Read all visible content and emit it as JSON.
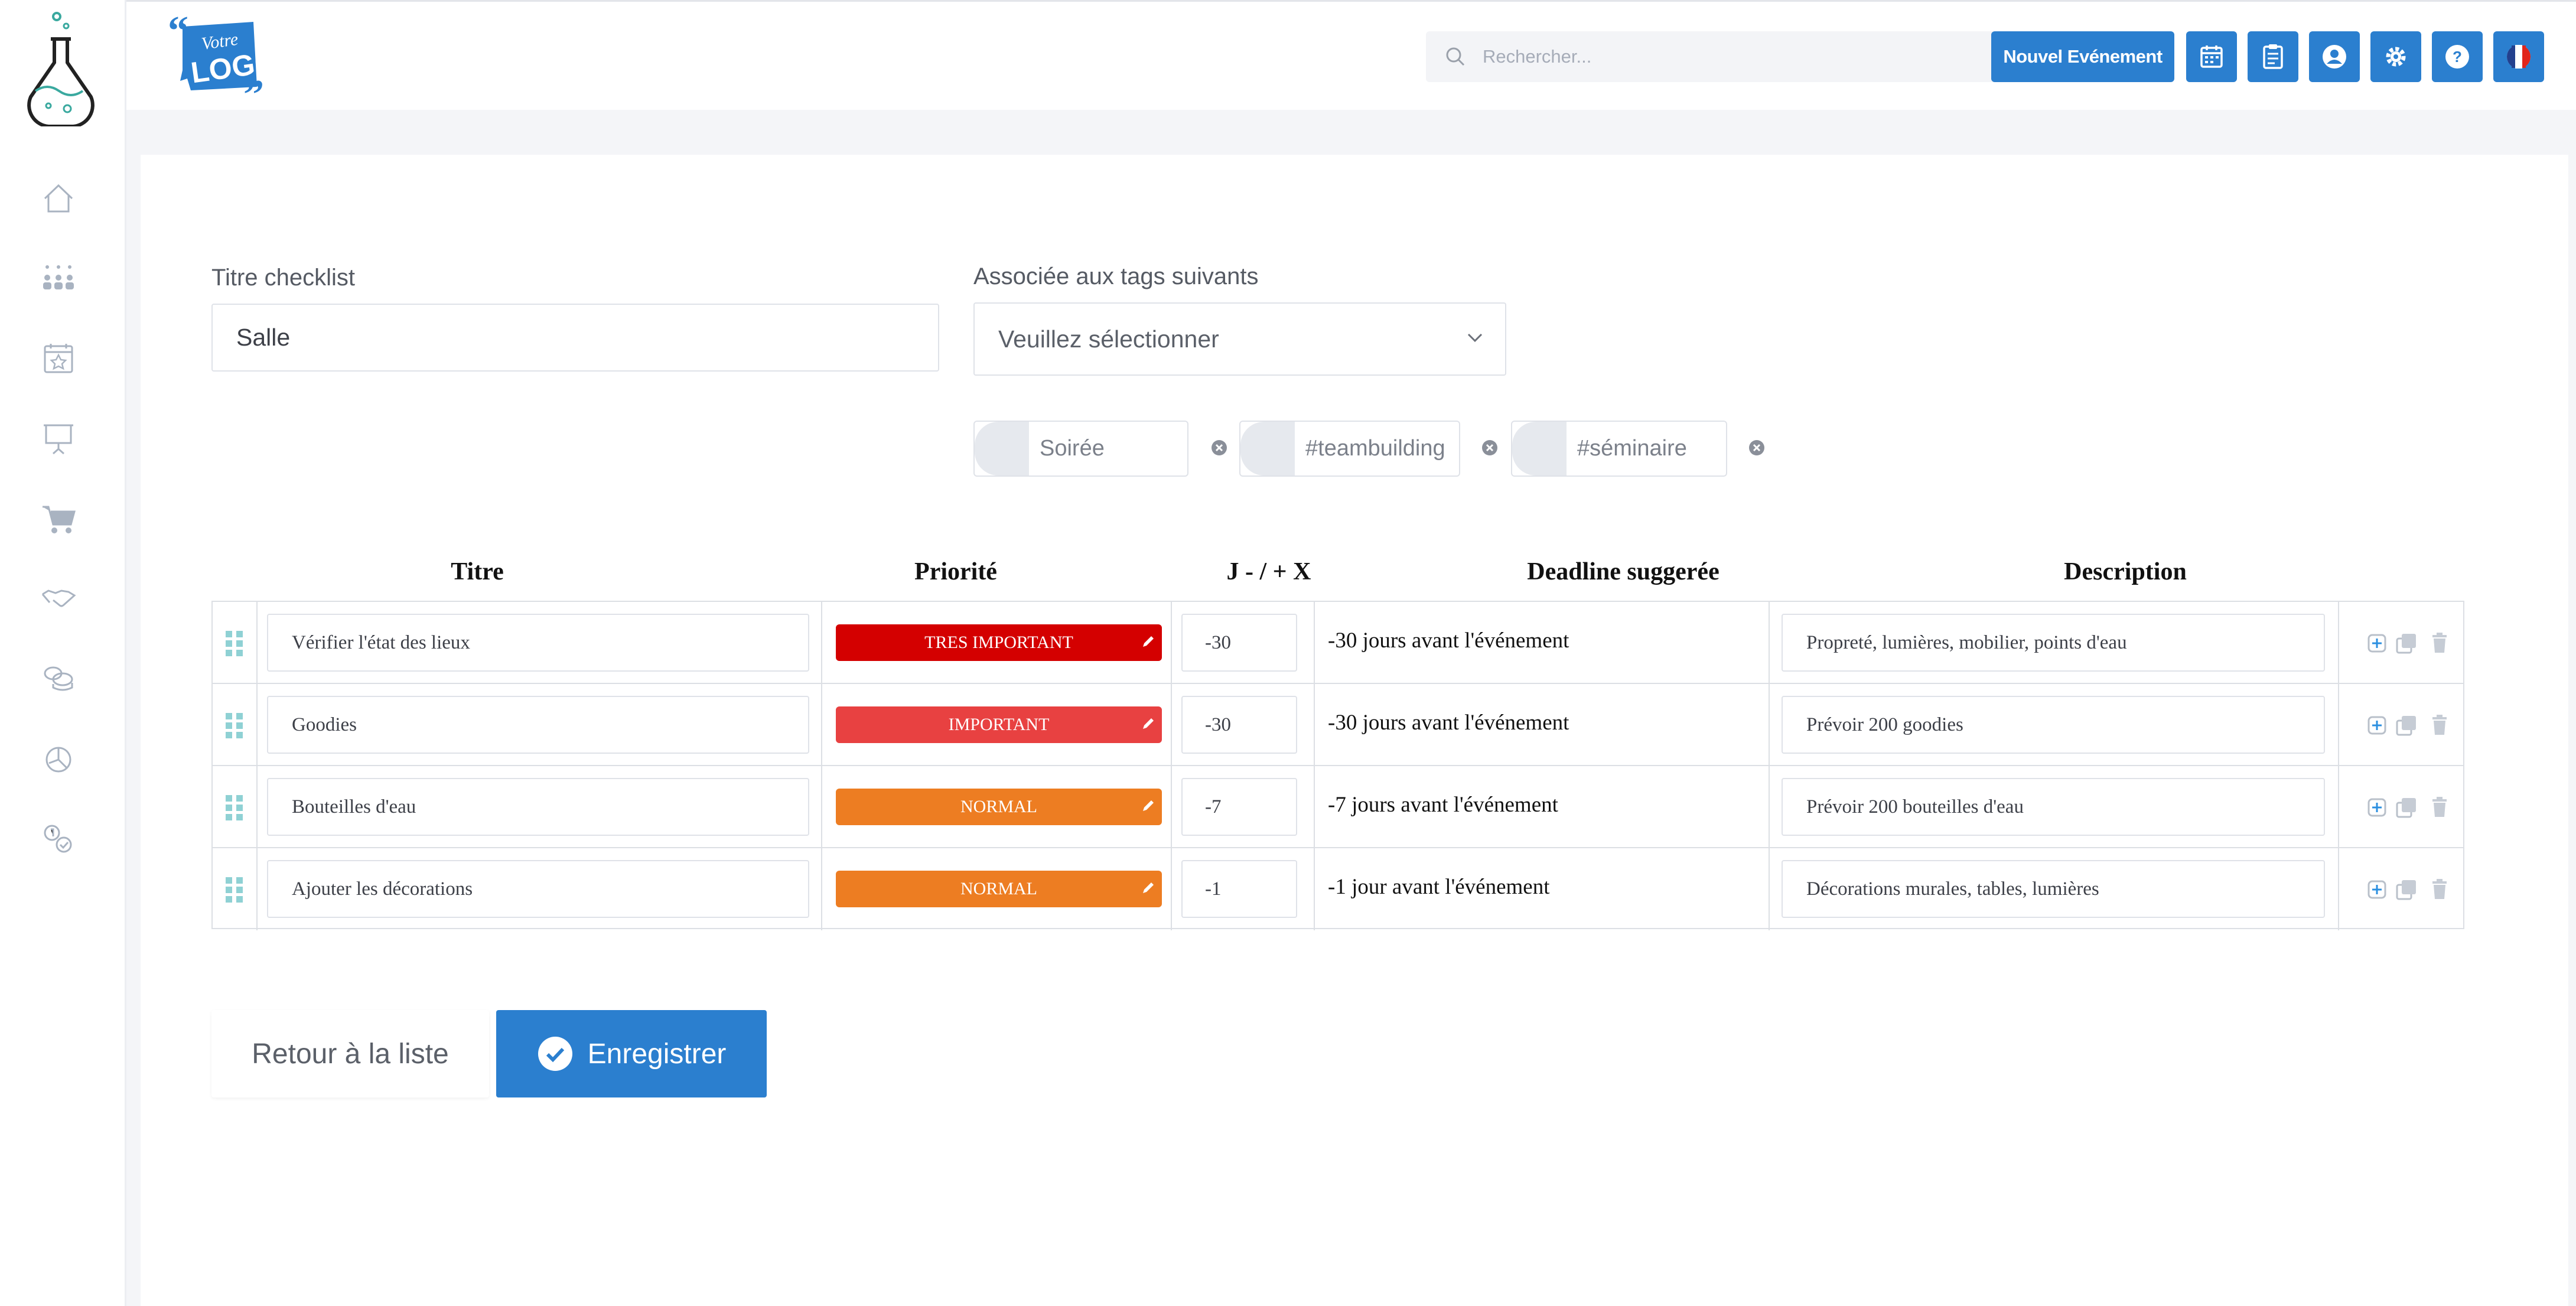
{
  "header": {
    "search_placeholder": "Rechercher...",
    "new_event_label": "Nouvel Evénement",
    "accent_color": "#2b7fcf"
  },
  "sidebar": {
    "items": [
      {
        "icon": "home-icon"
      },
      {
        "icon": "audience-icon"
      },
      {
        "icon": "calendar-star-icon"
      },
      {
        "icon": "presentation-icon"
      },
      {
        "icon": "cart-icon"
      },
      {
        "icon": "handshake-icon"
      },
      {
        "icon": "coins-icon"
      },
      {
        "icon": "pie-chart-icon"
      },
      {
        "icon": "money-check-icon"
      }
    ]
  },
  "form": {
    "title_label": "Titre checklist",
    "title_value": "Salle",
    "tags_label": "Associée aux tags suivants",
    "tags_select_value": "Veuillez sélectionner",
    "tags": [
      "Soirée",
      "#teambuilding",
      "#séminaire"
    ]
  },
  "table": {
    "headers": [
      "Titre",
      "Priorité",
      "J - / + X",
      "Deadline suggerée",
      "Description"
    ],
    "rows": [
      {
        "title": "Vérifier l'état des lieux",
        "priority": "TRES IMPORTANT",
        "priority_color": "#d40000",
        "offset": "-30",
        "deadline": "-30 jours avant l'événement",
        "description": "Propreté, lumières, mobilier, points d'eau"
      },
      {
        "title": "Goodies",
        "priority": "IMPORTANT",
        "priority_color": "#e84141",
        "offset": "-30",
        "deadline": "-30 jours avant l'événement",
        "description": "Prévoir 200 goodies"
      },
      {
        "title": "Bouteilles d'eau",
        "priority": "NORMAL",
        "priority_color": "#ed7d22",
        "offset": "-7",
        "deadline": "-7 jours avant l'événement",
        "description": "Prévoir 200 bouteilles d'eau"
      },
      {
        "title": "Ajouter les décorations",
        "priority": "NORMAL",
        "priority_color": "#ed7d22",
        "offset": "-1",
        "deadline": "-1 jour avant l'événement",
        "description": "Décorations murales, tables, lumières"
      }
    ]
  },
  "actions": {
    "back_label": "Retour à la liste",
    "save_label": "Enregistrer"
  }
}
